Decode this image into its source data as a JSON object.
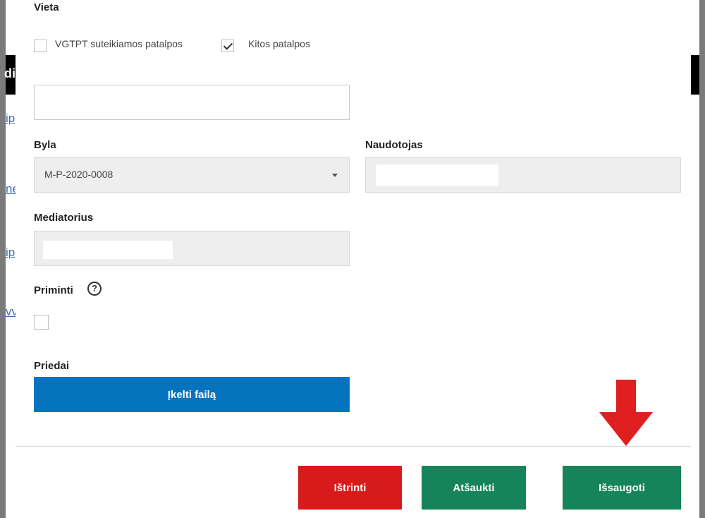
{
  "location": {
    "label": "Vieta",
    "options": [
      {
        "label": "VGTPT suteikiamos patalpos",
        "checked": false
      },
      {
        "label": "Kitos patalpos",
        "checked": true
      }
    ],
    "text_value": ""
  },
  "case": {
    "label": "Byla",
    "value": "M-P-2020-0008"
  },
  "user": {
    "label": "Naudotojas",
    "value": ""
  },
  "mediator": {
    "label": "Mediatorius",
    "value": ""
  },
  "remind": {
    "label": "Priminti",
    "help_glyph": "?",
    "checked": false
  },
  "attachments": {
    "label": "Priedai",
    "upload_label": "Įkelti failą"
  },
  "footer": {
    "delete_label": "Ištrinti",
    "cancel_label": "Atšaukti",
    "save_label": "Išsaugoti"
  },
  "colors": {
    "primary_blue": "#0673bf",
    "danger_red": "#d91a1a",
    "success_green": "#15845a",
    "annotation_arrow": "#e02020"
  },
  "background_page": {
    "fragments_left": [
      "di",
      "ip",
      "ne",
      "ip",
      "vv"
    ]
  }
}
